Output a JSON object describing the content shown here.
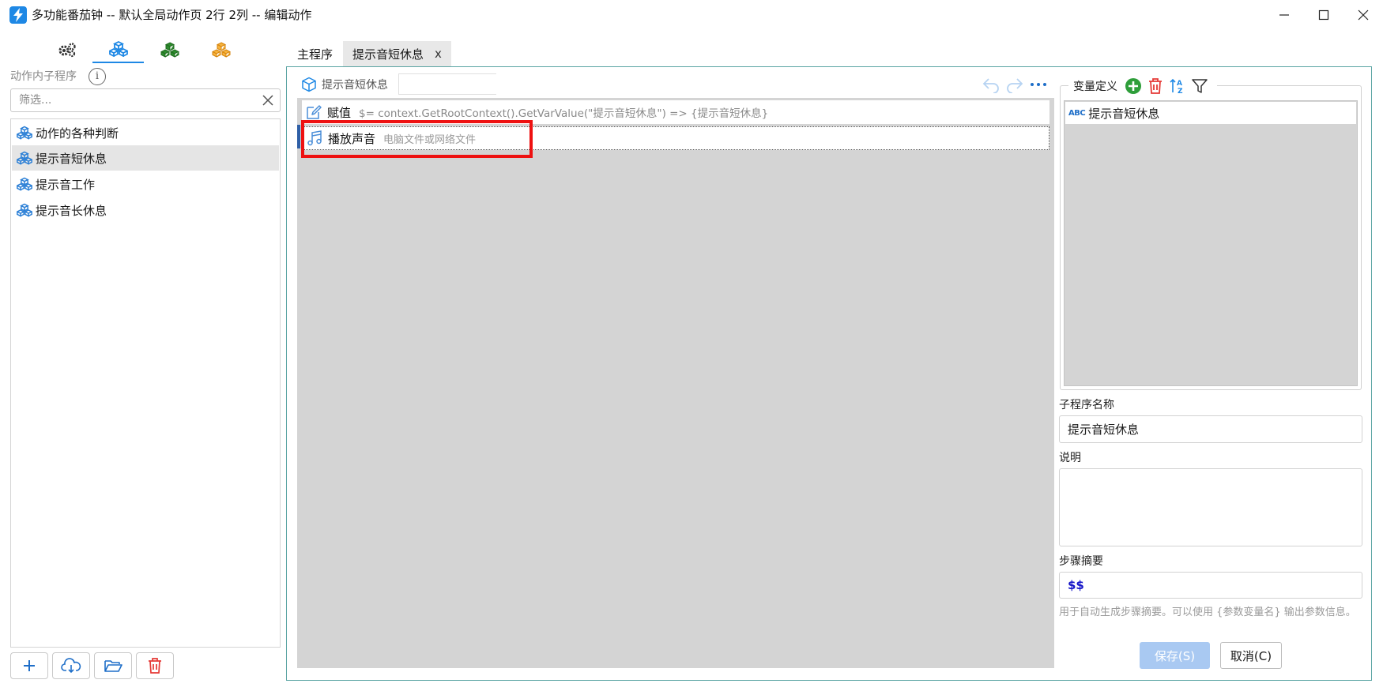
{
  "window": {
    "title": "多功能番茄钟 -- 默认全局动作页 2行 2列 -- 编辑动作"
  },
  "left_panel": {
    "tabs": [
      {
        "icon": "gears-icon",
        "color": "#333333"
      },
      {
        "icon": "cubes-icon",
        "color": "#1e88e5"
      },
      {
        "icon": "cubes-icon",
        "color": "#2e8b2e"
      },
      {
        "icon": "cubes-icon",
        "color": "#f39c12"
      }
    ],
    "header": "动作内子程序",
    "filter_placeholder": "筛选...",
    "items": [
      {
        "label": "动作的各种判断",
        "selected": false
      },
      {
        "label": "提示音短休息",
        "selected": true
      },
      {
        "label": "提示音工作",
        "selected": false
      },
      {
        "label": "提示音长休息",
        "selected": false
      }
    ],
    "bottom_buttons": [
      "add-icon",
      "cloud-download-icon",
      "folder-open-icon",
      "delete-icon"
    ]
  },
  "editor": {
    "tabs": [
      {
        "label": "主程序",
        "active": false
      },
      {
        "label": "提示音短休息",
        "active": true,
        "close": "x"
      }
    ],
    "program_name": "提示音短休息",
    "steps": [
      {
        "name": "赋值",
        "desc": "$=   context.GetRootContext().GetVarValue(\"提示音短休息\") => {提示音短休息}"
      },
      {
        "name": "播放声音",
        "desc": "电脑文件或网络文件"
      }
    ]
  },
  "right_panel": {
    "var_title": "变量定义",
    "variables": [
      {
        "type": "ABC",
        "name": "提示音短休息"
      }
    ],
    "subprogram_name_label": "子程序名称",
    "subprogram_name_value": "提示音短休息",
    "description_label": "说明",
    "description_value": "",
    "summary_label": "步骤摘要",
    "summary_value": "$$",
    "hint": "用于自动生成步骤摘要。可以使用 {参数变量名} 输出参数信息。",
    "save_label": "保存(S)",
    "cancel_label": "取消(C)"
  },
  "colors": {
    "accent": "#1e88e5",
    "frame": "#5aa4a3",
    "highlight": "#ee1111",
    "canvas": "#d4d4d4",
    "save_disabled": "#a9c9f2"
  }
}
